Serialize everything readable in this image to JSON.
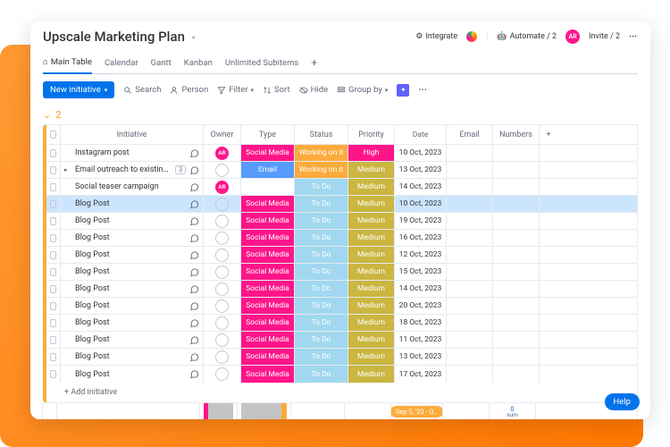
{
  "board": {
    "title": "Upscale Marketing Plan"
  },
  "header_actions": {
    "integrate": "Integrate",
    "automate": "Automate / 2",
    "avatar": "AR",
    "invite": "Invite / 2"
  },
  "tabs": {
    "main": "Main Table",
    "calendar": "Calendar",
    "gantt": "Gantt",
    "kanban": "Kanban",
    "subitems": "Unlimited Subitems"
  },
  "toolbar": {
    "new_initiative": "New initiative",
    "search": "Search",
    "person": "Person",
    "filter": "Filter",
    "sort": "Sort",
    "hide": "Hide",
    "groupby": "Group by"
  },
  "group": {
    "count": "2"
  },
  "columns": {
    "initiative": "Initiative",
    "owner": "Owner",
    "type": "Type",
    "status": "Status",
    "priority": "Priority",
    "date": "Date",
    "email": "Email",
    "numbers": "Numbers"
  },
  "colors": {
    "pink": "#ff158a",
    "blue": "#579bfc",
    "lightblue": "#a1d8f0",
    "olive": "#cab641",
    "orange": "#fdab3d",
    "grey": "#c4c4c4"
  },
  "rows": [
    {
      "name": "Instagram post",
      "owner": "AR",
      "owner_filled": true,
      "type": "Social Media",
      "type_color": "pink",
      "status": "Working on it",
      "status_color": "orange",
      "priority": "High",
      "priority_color": "pink",
      "date": "10 Oct, 2023",
      "count": null,
      "expand": false,
      "highlight": false
    },
    {
      "name": "Email outreach to existing …",
      "owner": "",
      "owner_filled": false,
      "type": "Email",
      "type_color": "blue",
      "status": "Working on it",
      "status_color": "orange",
      "priority": "Medium",
      "priority_color": "olive",
      "date": "13 Oct, 2023",
      "count": "3",
      "expand": true,
      "highlight": false
    },
    {
      "name": "Social teaser campaign",
      "owner": "AR",
      "owner_filled": true,
      "type": "",
      "type_color": null,
      "status": "To Do",
      "status_color": "lightblue",
      "priority": "Medium",
      "priority_color": "olive",
      "date": "14 Oct, 2023",
      "count": null,
      "expand": false,
      "highlight": false
    },
    {
      "name": "Blog Post",
      "owner": "",
      "owner_filled": false,
      "type": "Social Media",
      "type_color": "pink",
      "status": "To Do",
      "status_color": "lightblue",
      "priority": "Medium",
      "priority_color": "olive",
      "date": "10 Oct, 2023",
      "count": null,
      "expand": false,
      "highlight": true
    },
    {
      "name": "Blog Post",
      "owner": "",
      "owner_filled": false,
      "type": "Social Media",
      "type_color": "pink",
      "status": "To Do",
      "status_color": "lightblue",
      "priority": "Medium",
      "priority_color": "olive",
      "date": "19 Oct, 2023",
      "count": null,
      "expand": false,
      "highlight": false
    },
    {
      "name": "Blog Post",
      "owner": "",
      "owner_filled": false,
      "type": "Social Media",
      "type_color": "pink",
      "status": "To Do",
      "status_color": "lightblue",
      "priority": "Medium",
      "priority_color": "olive",
      "date": "16 Oct, 2023",
      "count": null,
      "expand": false,
      "highlight": false
    },
    {
      "name": "Blog Post",
      "owner": "",
      "owner_filled": false,
      "type": "Social Media",
      "type_color": "pink",
      "status": "To Do",
      "status_color": "lightblue",
      "priority": "Medium",
      "priority_color": "olive",
      "date": "12 Oct, 2023",
      "count": null,
      "expand": false,
      "highlight": false
    },
    {
      "name": "Blog Post",
      "owner": "",
      "owner_filled": false,
      "type": "Social Media",
      "type_color": "pink",
      "status": "To Do",
      "status_color": "lightblue",
      "priority": "Medium",
      "priority_color": "olive",
      "date": "15 Oct, 2023",
      "count": null,
      "expand": false,
      "highlight": false
    },
    {
      "name": "Blog Post",
      "owner": "",
      "owner_filled": false,
      "type": "Social Media",
      "type_color": "pink",
      "status": "To Do",
      "status_color": "lightblue",
      "priority": "Medium",
      "priority_color": "olive",
      "date": "14 Oct, 2023",
      "count": null,
      "expand": false,
      "highlight": false
    },
    {
      "name": "Blog Post",
      "owner": "",
      "owner_filled": false,
      "type": "Social Media",
      "type_color": "pink",
      "status": "To Do",
      "status_color": "lightblue",
      "priority": "Medium",
      "priority_color": "olive",
      "date": "20 Oct, 2023",
      "count": null,
      "expand": false,
      "highlight": false
    },
    {
      "name": "Blog Post",
      "owner": "",
      "owner_filled": false,
      "type": "Social Media",
      "type_color": "pink",
      "status": "To Do",
      "status_color": "lightblue",
      "priority": "Medium",
      "priority_color": "olive",
      "date": "18 Oct, 2023",
      "count": null,
      "expand": false,
      "highlight": false
    },
    {
      "name": "Blog Post",
      "owner": "",
      "owner_filled": false,
      "type": "Social Media",
      "type_color": "pink",
      "status": "To Do",
      "status_color": "lightblue",
      "priority": "Medium",
      "priority_color": "olive",
      "date": "11 Oct, 2023",
      "count": null,
      "expand": false,
      "highlight": false
    },
    {
      "name": "Blog Post",
      "owner": "",
      "owner_filled": false,
      "type": "Social Media",
      "type_color": "pink",
      "status": "To Do",
      "status_color": "lightblue",
      "priority": "Medium",
      "priority_color": "olive",
      "date": "13 Oct, 2023",
      "count": null,
      "expand": false,
      "highlight": false
    },
    {
      "name": "Blog Post",
      "owner": "",
      "owner_filled": false,
      "type": "Social Media",
      "type_color": "pink",
      "status": "To Do",
      "status_color": "lightblue",
      "priority": "Medium",
      "priority_color": "olive",
      "date": "17 Oct, 2023",
      "count": null,
      "expand": false,
      "highlight": false
    }
  ],
  "add_row": "+ Add initiative",
  "summary": {
    "date_range": "Sep 5, '23 - O…",
    "num_value": "0",
    "num_label": "sum"
  },
  "help": "Help"
}
